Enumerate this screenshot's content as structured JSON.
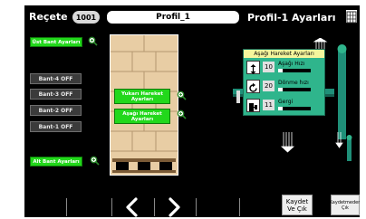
{
  "header": {
    "recipe_label": "Reçete",
    "recipe_number": "1001",
    "profile_name": "Profil_1",
    "title": "Profil-1 Ayarları"
  },
  "left_panel": {
    "top_band_button": "Üst Bant Ayarları",
    "bottom_band_button": "Alt Bant Ayarları",
    "band_buttons": [
      "Bant-4 OFF",
      "Bant-3 OFF",
      "Bant-2 OFF",
      "Bant-1 OFF"
    ]
  },
  "center_panel": {
    "up_move_button": "Yukarı Hareket Ayarları",
    "down_move_button": "Aşağı Hareket Ayarları"
  },
  "settings_popup": {
    "title": "Aşağı Hareket Ayarları",
    "rows": [
      {
        "label": "Aşağı Hızı",
        "value": "10",
        "icon": "arrows-up-down-icon",
        "level": 0.15
      },
      {
        "label": "Dönme hızı",
        "value": "20",
        "icon": "rotate-icon",
        "level": 0.15
      },
      {
        "label": "Gergi",
        "value": "11",
        "icon": "tension-icon",
        "level": 0.15
      }
    ]
  },
  "footer": {
    "prev_icon": "chevron-left-icon",
    "next_icon": "chevron-right-icon",
    "save_exit_button": "Kaydet\nVe Çık",
    "save_as_button": "Kaydetmeden\nÇık"
  },
  "colors": {
    "green": "#22d81b",
    "popup_bg": "#2fb58c",
    "teal": "#1f8f78",
    "popup_title_bg": "#f5f59c",
    "wood": "#e8cda4",
    "wood_grid": "#b59870"
  }
}
